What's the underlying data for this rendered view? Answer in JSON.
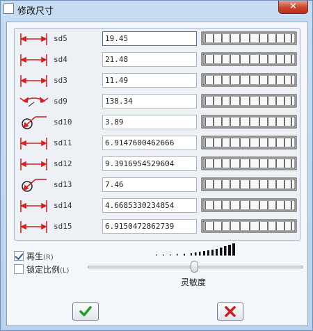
{
  "window": {
    "title": "修改尺寸",
    "close_label": "✕"
  },
  "dimensions": [
    {
      "name": "sd5",
      "value": "19.45",
      "icon": "linear-dimension-icon",
      "active": true
    },
    {
      "name": "sd4",
      "value": "21.48",
      "icon": "linear-dimension-icon"
    },
    {
      "name": "sd3",
      "value": "11.49",
      "icon": "linear-dimension-icon"
    },
    {
      "name": "sd9",
      "value": "138.34",
      "icon": "angular-dimension-icon"
    },
    {
      "name": "sd10",
      "value": "3.89",
      "icon": "diameter-dimension-icon"
    },
    {
      "name": "sd11",
      "value": "6.9147600462666",
      "icon": "linear-dimension-icon"
    },
    {
      "name": "sd12",
      "value": "9.3916954529604",
      "icon": "linear-dimension-icon"
    },
    {
      "name": "sd13",
      "value": "7.46",
      "icon": "diameter-dimension-icon"
    },
    {
      "name": "sd14",
      "value": "4.6685330234854",
      "icon": "linear-dimension-icon"
    },
    {
      "name": "sd15",
      "value": "6.9150472862739",
      "icon": "linear-dimension-icon"
    }
  ],
  "options": {
    "regenerate_label": "再生",
    "regenerate_accel": "(R)",
    "regenerate_checked": true,
    "lock_ratio_label": "锁定比例",
    "lock_ratio_accel": "(L)",
    "lock_ratio_checked": false
  },
  "sensitivity": {
    "label": "灵敏度",
    "level": 0.5
  },
  "buttons": {
    "ok_icon": "checkmark-icon",
    "cancel_icon": "x-icon"
  },
  "colors": {
    "ok_green": "#1f9e2a",
    "cancel_red": "#cc1f1f",
    "dimension_red": "#d42020"
  }
}
